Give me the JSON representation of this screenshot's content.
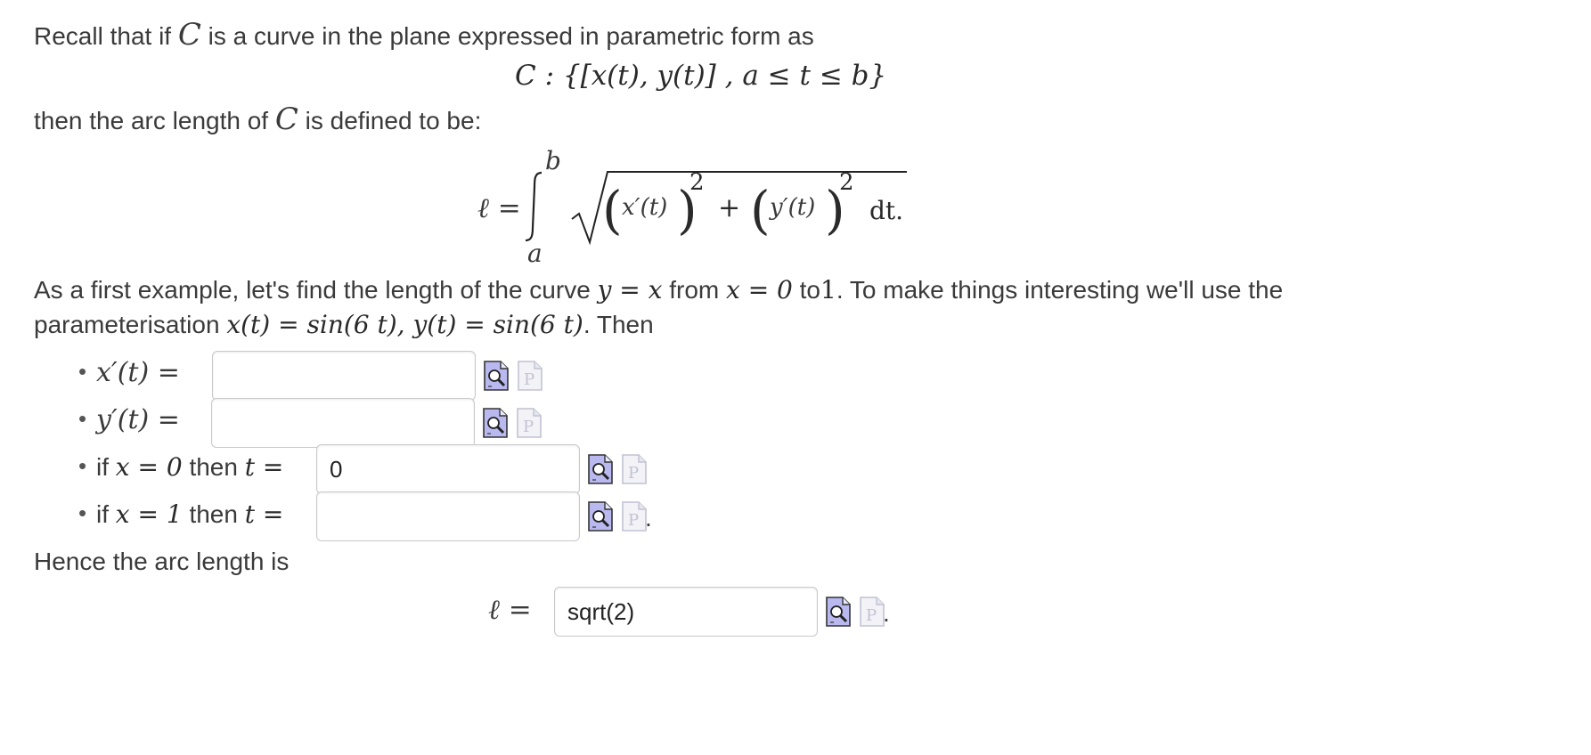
{
  "intro": {
    "line1_pre": "Recall that if",
    "line1_post": "is a curve in the plane expressed in parametric form as",
    "curve_letter": "C",
    "curve_def": "C : {[x(t), y(t)] , a ≤ t ≤ b}",
    "line2_pre": "then the arc length of",
    "line2_post": "is defined to be:"
  },
  "formula": {
    "ell": "ℓ =",
    "upper": "b",
    "lower": "a",
    "integrand_x": "x′(t)",
    "integrand_y": "y′(t)",
    "exponent": "2",
    "plus": "+",
    "dt": "dt."
  },
  "example": {
    "text1_a": "As a first example, let's find the length of the curve",
    "eq1": "y = x",
    "text1_b": "from",
    "eq2": "x = 0",
    "text1_c": "to",
    "num1": "1",
    "text1_d": ". To make things interesting we'll use the",
    "text2_a": "parameterisation",
    "eq3": "x(t) = sin(6 t), y(t) = sin(6 t)",
    "text2_b": ". Then"
  },
  "items": [
    {
      "label": "x′(t) =",
      "value": "",
      "placeholder": ""
    },
    {
      "label": "y′(t) =",
      "value": "",
      "placeholder": ""
    },
    {
      "label_pre": "if",
      "label_eq": "x = 0",
      "label_mid": "then",
      "label_var": "t =",
      "value": "0"
    },
    {
      "label_pre": "if",
      "label_eq": "x = 1",
      "label_mid": "then",
      "label_var": "t =",
      "value": ""
    }
  ],
  "conclusion": {
    "text": "Hence the arc length is",
    "ell": "ℓ =",
    "value": "sqrt(2)"
  },
  "icons": {
    "preview": "preview-magnifier-icon",
    "syntax": "syntax-p-icon",
    "preview_color": "#b9b9f0",
    "syntax_color": "#c8c8dc"
  },
  "punct": {
    "period": "."
  }
}
